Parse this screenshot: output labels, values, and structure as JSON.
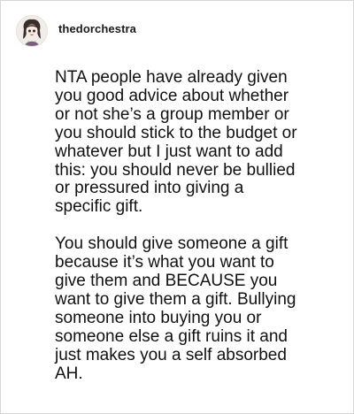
{
  "post": {
    "username": "thedorchestra",
    "avatar_icon": "cartoon-portrait-avatar",
    "paragraphs": [
      "NTA people have already given\nyou good advice about whether\nor not she’s a group member or\nyou should stick to the budget or\nwhatever but I just want to add\nthis: you should never be bullied\nor pressured into giving a\nspecific gift.",
      "You should give someone a gift\nbecause it’s what you want to\ngive them and BECAUSE you\nwant to give them a gift. Bullying\nsomeone into buying you or\nsomeone else a gift ruins it and\njust makes you a self absorbed\nAH."
    ]
  }
}
